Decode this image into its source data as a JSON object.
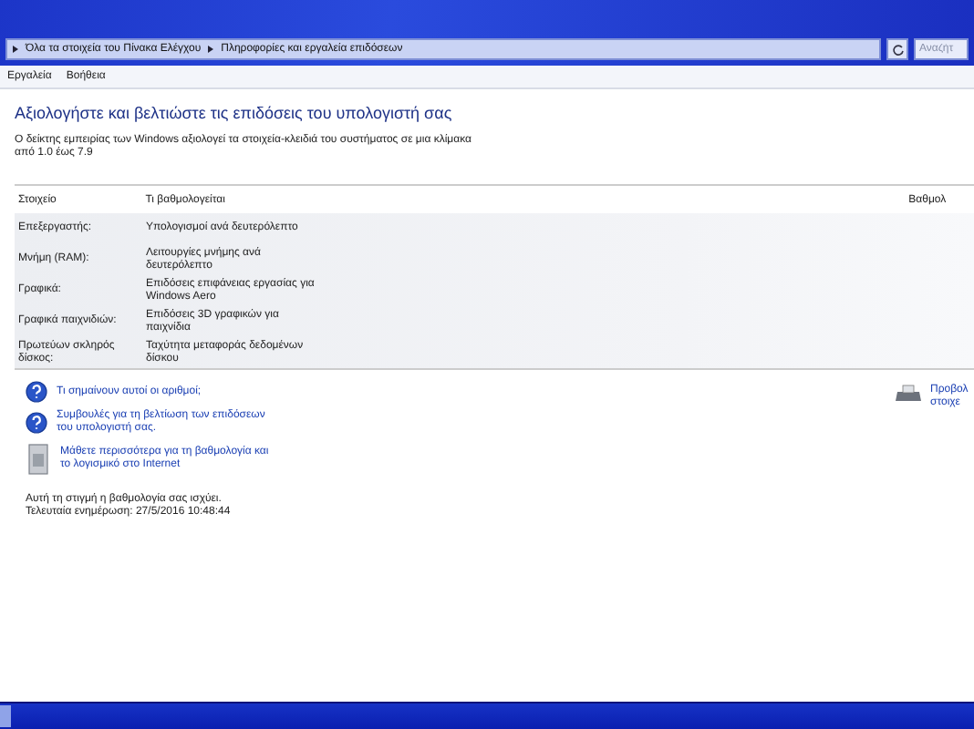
{
  "address_bar": {
    "crumbs": [
      "Όλα τα στοιχεία του Πίνακα Ελέγχου",
      "Πληροφορίες και εργαλεία επιδόσεων"
    ],
    "search_placeholder": "Αναζήτ"
  },
  "menu": [
    "Εργαλεία",
    "Βοήθεια"
  ],
  "heading": "Αξιολογήστε και βελτιώστε τις επιδόσεις του υπολογιστή σας",
  "description": "Ο δείκτης εμπειρίας των Windows αξιολογεί τα στοιχεία-κλειδιά του συστήματος σε μια κλίμακα από 1.0 έως 7.9",
  "table": {
    "columns": [
      "Στοιχείο",
      "Τι βαθμολογείται",
      "Βαθμολ"
    ],
    "rows": [
      {
        "component": "Επεξεργαστής:",
        "rated": "Υπολογισμοί ανά δευτερόλεπτο"
      },
      {
        "component": "Μνήμη (RAM):",
        "rated": "Λειτουργίες μνήμης ανά δευτερόλεπτο"
      },
      {
        "component": "Γραφικά:",
        "rated": "Επιδόσεις επιφάνειας εργασίας για Windows Aero"
      },
      {
        "component": "Γραφικά παιχνιδιών:",
        "rated": "Επιδόσεις 3D γραφικών για παιχνίδια"
      },
      {
        "component": "Πρωτεύων σκληρός δίσκος:",
        "rated": "Ταχύτητα μεταφοράς δεδομένων δίσκου"
      }
    ]
  },
  "links": [
    {
      "kind": "help",
      "text": "Τι σημαίνουν αυτοί οι αριθμοί;"
    },
    {
      "kind": "help",
      "text": "Συμβουλές για τη βελτίωση των επιδόσεων του υπολογιστή σας."
    },
    {
      "kind": "software",
      "text": "Μάθετε περισσότερα για τη βαθμολογία και το λογισμικό στο Internet"
    }
  ],
  "side_link": "Προβολ στοιχε",
  "status": [
    "Αυτή τη στιγμή η βαθμολογία σας ισχύει.",
    "Τελευταία ενημέρωση: 27/5/2016 10:48:44"
  ]
}
